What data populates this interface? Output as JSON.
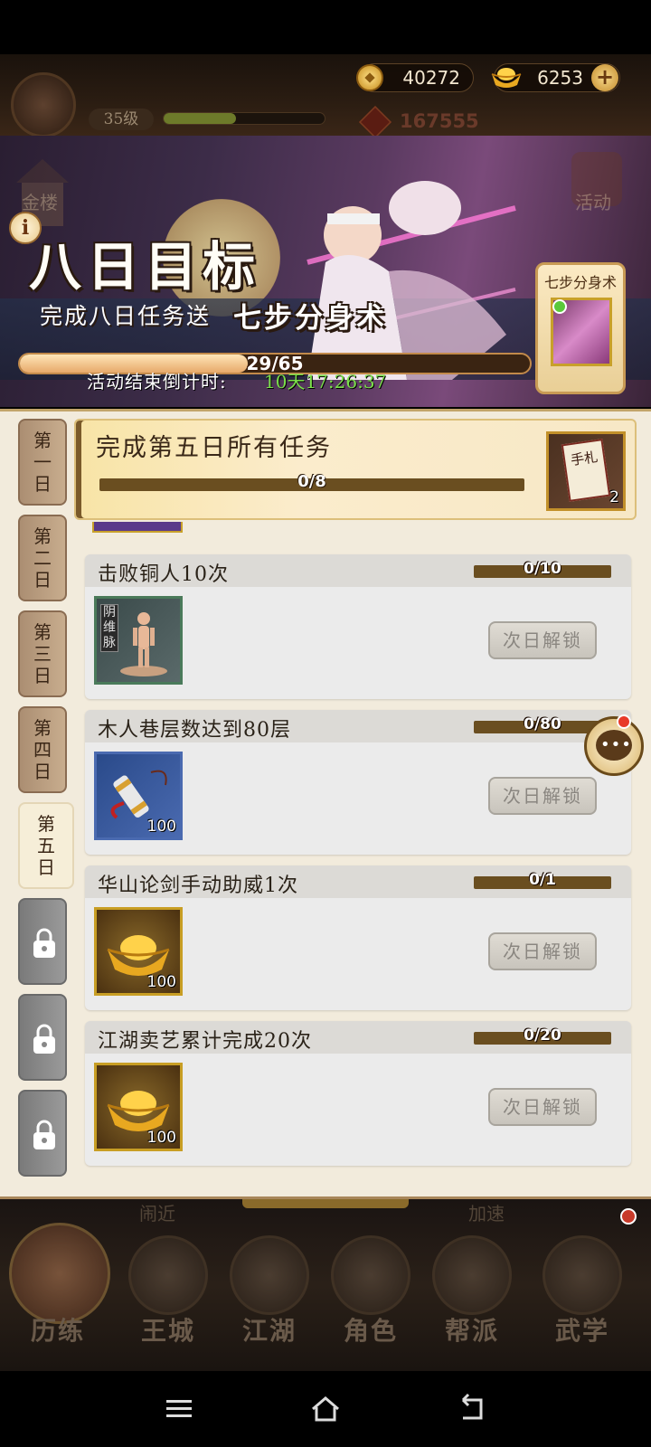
{
  "hud": {
    "level": "35级",
    "level_progress": 0.45,
    "coins": "40272",
    "ingots": "6253",
    "power": "167555",
    "coin_icon": "coin-icon",
    "ingot_icon": "gold-ingot-icon",
    "add_icon": "plus-icon"
  },
  "banner": {
    "side_building_label": "金楼",
    "side_activity_label": "活动",
    "title": "八日目标",
    "subtitle": "完成八日任务送",
    "skill_name": "七步分身术",
    "progress_text": "29/65",
    "progress_value": 29,
    "progress_max": 65,
    "countdown_label": "活动结束倒计时:",
    "countdown_value": "10天17:26:37",
    "reward_title": "七步分身术"
  },
  "tabs": [
    {
      "line1": "第",
      "line2": "一",
      "line3": "日"
    },
    {
      "line1": "第",
      "line2": "二",
      "line3": "日"
    },
    {
      "line1": "第",
      "line2": "三",
      "line3": "日"
    },
    {
      "line1": "第",
      "line2": "四",
      "line3": "日"
    },
    {
      "line1": "第",
      "line2": "五",
      "line3": "日"
    }
  ],
  "header_task": {
    "title": "完成第五日所有任务",
    "progress": "0/8",
    "reward_label": "手札",
    "reward_count": "2"
  },
  "tasks": [
    {
      "title": "击败铜人10次",
      "progress": "0/10",
      "item_label": "阴维脉",
      "count": "",
      "button": "次日解锁"
    },
    {
      "title": "木人巷层数达到80层",
      "progress": "0/80",
      "item_label": "",
      "count": "100",
      "button": "次日解锁"
    },
    {
      "title": "华山论剑手动助威1次",
      "progress": "0/1",
      "item_label": "",
      "count": "100",
      "button": "次日解锁"
    },
    {
      "title": "江湖卖艺累计完成20次",
      "progress": "0/20",
      "item_label": "",
      "count": "100",
      "button": "次日解锁"
    }
  ],
  "bottom_nav": {
    "ghost_left": "闹近",
    "ghost_right": "加速",
    "items": [
      "历练",
      "王城",
      "江湖",
      "角色",
      "帮派",
      "武学"
    ]
  },
  "colors": {
    "accent_gold": "#c89e24",
    "progress_green": "#7be04a",
    "panel_bg": "#f2ebdc"
  }
}
